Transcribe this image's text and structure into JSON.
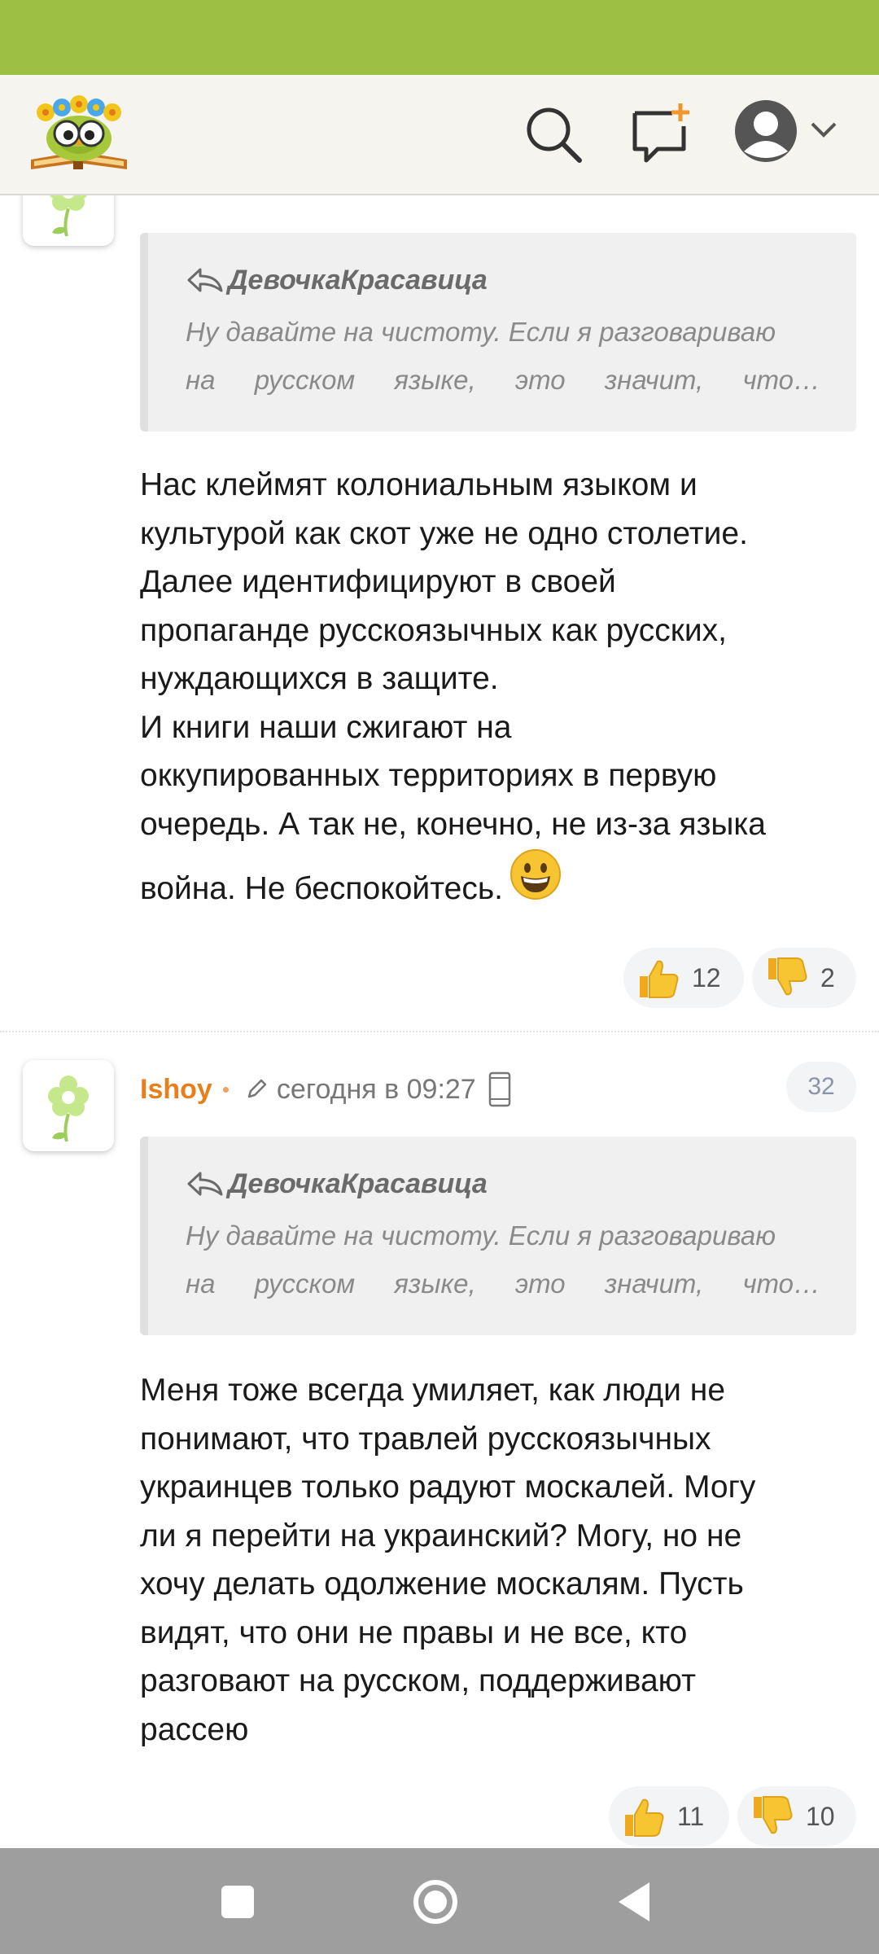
{
  "colors": {
    "status_bar": "#9dc044",
    "header_bg": "#f5f4ef",
    "author": "#e87f1a",
    "nav_bar": "#9e9e9e"
  },
  "header": {
    "logo": "owl-on-book-logo",
    "icons": [
      "search-icon",
      "new-post-icon",
      "user-avatar-icon",
      "chevron-down-icon"
    ]
  },
  "comments": [
    {
      "quote": {
        "author": "ДевочкаКрасавица",
        "line1": "Ну давайте на чистоту. Если я разговариваю",
        "line2": "на русском языке, это значит, что…"
      },
      "text": "Нас клеймят колониальным языком и\nкультурой как скот уже не одно столетие.\nДалее идентифицируют в своей\nпропаганде русскоязычных как русских,\nнуждающихся в защите.\nИ книги наши сжигают на\nоккупированных территориях в первую\nочередь. А так не, конечно, не из-за языка\nвойна. Не беспокойтесь.",
      "likes": "12",
      "dislikes": "2"
    },
    {
      "author": "Ishoy",
      "time": "сегодня в 09:27",
      "number": "32",
      "quote": {
        "author": "ДевочкаКрасавица",
        "line1": "Ну давайте на чистоту. Если я разговариваю",
        "line2": "на русском языке, это значит, что…"
      },
      "text": "Меня тоже всегда умиляет, как люди не\nпонимают, что травлей русскоязычных\nукраинцев только радуют москалей. Могу\nли я перейти на украинский? Могу, но не\nхочу делать одолжение москалям. Пусть\nвидят, что они не правы и не все, кто\nразговают на русском, поддерживают\nрассею",
      "likes": "11",
      "dislikes": "10"
    }
  ],
  "nav": {
    "icons": [
      "recents-square-icon",
      "home-circle-icon",
      "back-triangle-icon"
    ]
  }
}
